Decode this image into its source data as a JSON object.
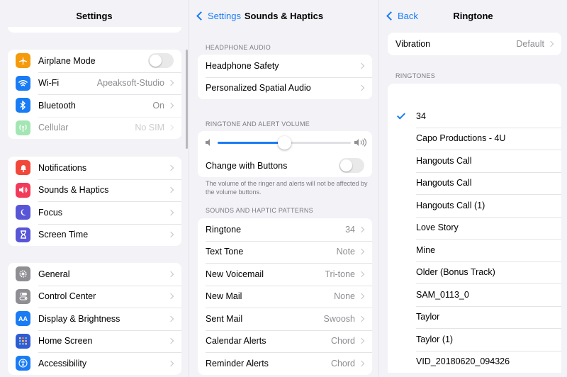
{
  "settings": {
    "title": "Settings",
    "group1": [
      {
        "label": "Airplane Mode",
        "icon": "airplane-icon",
        "color": "#f59a0b",
        "toggle": true
      },
      {
        "label": "Wi-Fi",
        "icon": "wifi-icon",
        "color": "#1a7cf5",
        "value": "Apeaksoft-Studio"
      },
      {
        "label": "Bluetooth",
        "icon": "bluetooth-icon",
        "color": "#1a7cf5",
        "value": "On"
      },
      {
        "label": "Cellular",
        "icon": "cellular-icon",
        "color": "#34c759",
        "value": "No SIM",
        "dimmed": true
      }
    ],
    "group2": [
      {
        "label": "Notifications",
        "icon": "bell-icon",
        "color": "#f2483a"
      },
      {
        "label": "Sounds & Haptics",
        "icon": "speaker-icon",
        "color": "#f23a5a"
      },
      {
        "label": "Focus",
        "icon": "moon-icon",
        "color": "#5856d6"
      },
      {
        "label": "Screen Time",
        "icon": "hourglass-icon",
        "color": "#5856d6"
      }
    ],
    "group3": [
      {
        "label": "General",
        "icon": "gear-icon",
        "color": "#8e8e93"
      },
      {
        "label": "Control Center",
        "icon": "switches-icon",
        "color": "#8e8e93"
      },
      {
        "label": "Display & Brightness",
        "icon": "text-size-icon",
        "color": "#1a7cf5",
        "glyph": "AA"
      },
      {
        "label": "Home Screen",
        "icon": "grid-icon",
        "color": "#2f5bd8"
      },
      {
        "label": "Accessibility",
        "icon": "accessibility-icon",
        "color": "#1a7cf5"
      }
    ]
  },
  "sounds": {
    "back_label": "Settings",
    "title": "Sounds & Haptics",
    "headphone_header": "HEADPHONE AUDIO",
    "headphone_rows": [
      "Headphone Safety",
      "Personalized Spatial Audio"
    ],
    "volume_header": "RINGTONE AND ALERT VOLUME",
    "volume_level": 0.5,
    "change_with_buttons": "Change with Buttons",
    "volume_footnote": "The volume of the ringer and alerts will not be affected by the volume buttons.",
    "patterns_header": "SOUNDS AND HAPTIC PATTERNS",
    "patterns": [
      {
        "label": "Ringtone",
        "value": "34"
      },
      {
        "label": "Text Tone",
        "value": "Note"
      },
      {
        "label": "New Voicemail",
        "value": "Tri-tone"
      },
      {
        "label": "New Mail",
        "value": "None"
      },
      {
        "label": "Sent Mail",
        "value": "Swoosh"
      },
      {
        "label": "Calendar Alerts",
        "value": "Chord"
      },
      {
        "label": "Reminder Alerts",
        "value": "Chord"
      }
    ]
  },
  "ringtone": {
    "back_label": "Back",
    "title": "Ringtone",
    "vibration_label": "Vibration",
    "vibration_value": "Default",
    "ringtones_header": "RINGTONES",
    "selected_index": 0,
    "items": [
      "34",
      "Capo Productions - 4U",
      "Hangouts Call",
      "Hangouts Call",
      "Hangouts Call (1)",
      "Love Story",
      "Mine",
      "Older (Bonus Track)",
      "SAM_0113_0",
      "Taylor",
      "Taylor (1)",
      "VID_20180620_094326"
    ]
  }
}
